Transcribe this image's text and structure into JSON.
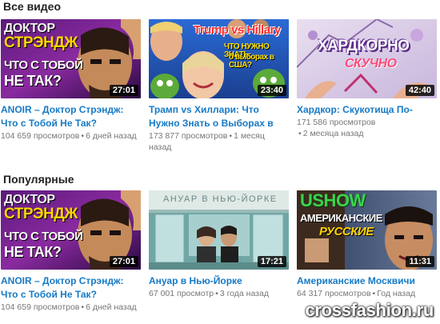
{
  "sections": [
    {
      "title": "Все видео",
      "videos": [
        {
          "title": "ANOIR – Доктор Стрэндж: Что с Тобой Не Так?",
          "views": "104 659 просмотров",
          "age": "6 дней назад",
          "duration": "27:01",
          "thumb_text": [
            "Доктор",
            "Стрэндж",
            "что с тобой",
            "не так?"
          ],
          "thumb_icon": "doctor-strange-thumbnail"
        },
        {
          "title": "Трамп vs Хиллари: Что Нужно Знать о Выборах в США?",
          "views": "173 877 просмотров",
          "age": "1 месяц назад",
          "duration": "23:40",
          "thumb_text": [
            "Trump vs Hillary",
            "что нужно знать",
            "о выборах в США?"
          ],
          "thumb_icon": "election-thumbnail"
        },
        {
          "title": "Хардкор: Скукотища По-Русски",
          "views": "171 586 просмотров",
          "age": "2 месяца назад",
          "duration": "42:40",
          "thumb_text": [
            "Хардкорно",
            "скучно"
          ],
          "thumb_icon": "hardcore-thumbnail"
        }
      ]
    },
    {
      "title": "Популярные",
      "videos": [
        {
          "title": "ANOIR – Доктор Стрэндж: Что с Тобой Не Так?",
          "views": "104 659 просмотров",
          "age": "6 дней назад",
          "duration": "27:01",
          "thumb_text": [
            "Доктор",
            "Стрэндж",
            "что с тобой",
            "не так?"
          ],
          "thumb_icon": "doctor-strange-thumbnail"
        },
        {
          "title": "Ануар в Нью-Йорке",
          "views": "67 001 просмотр",
          "age": "3 года назад",
          "duration": "17:21",
          "thumb_text": [
            "Ануар в Нью-Йорке"
          ],
          "thumb_icon": "new-york-subway-thumbnail"
        },
        {
          "title": "Американские Москвичи",
          "views": "64 317 просмотров",
          "age": "Год назад",
          "duration": "11:31",
          "thumb_text": [
            "Ushow",
            "Американские",
            "русские"
          ],
          "thumb_icon": "ushow-thumbnail"
        }
      ]
    }
  ],
  "watermark": "crossfashion.ru",
  "colors": {
    "link": "#167ac6",
    "meta": "#767676",
    "heading": "#222222",
    "duration_bg": "#000000"
  }
}
